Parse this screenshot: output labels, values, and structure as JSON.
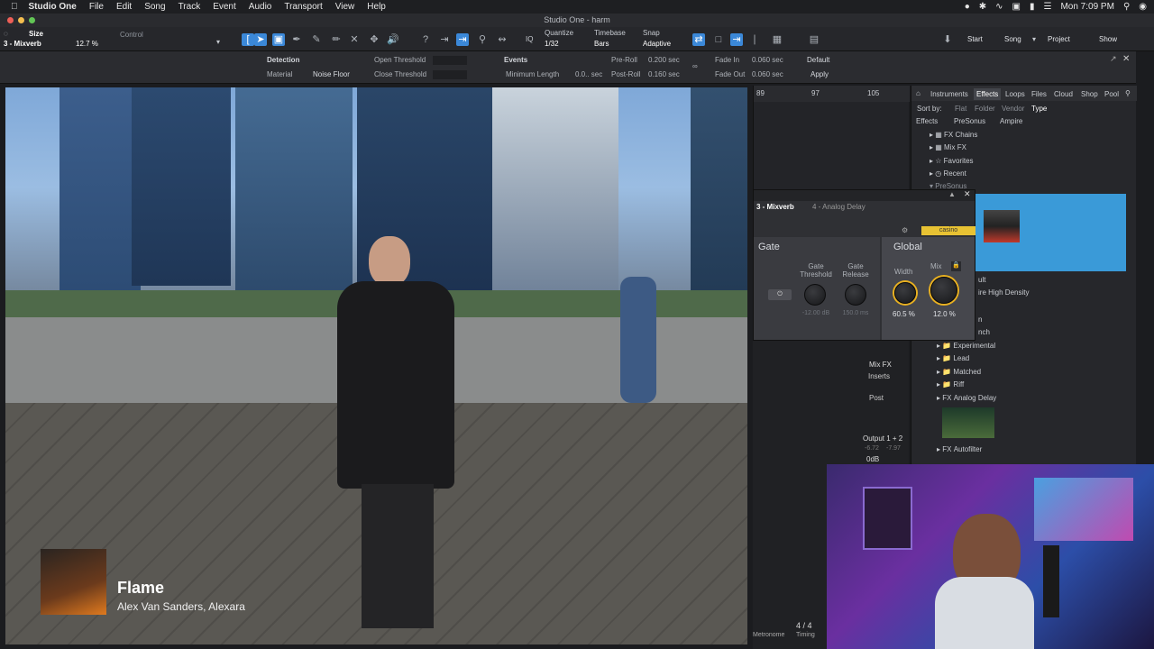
{
  "menubar": {
    "app": "Studio One",
    "items": [
      "File",
      "Edit",
      "Song",
      "Track",
      "Event",
      "Audio",
      "Transport",
      "View",
      "Help"
    ],
    "clock": "Mon 7:09 PM"
  },
  "window": {
    "title": "Studio One - harm"
  },
  "toolbar": {
    "track_name": "3 - Mixverb",
    "size_label": "Size",
    "size_value": "12.7 %",
    "control_label": "Control",
    "quantize_label": "Quantize",
    "quantize_value": "1/32",
    "timebase_label": "Timebase",
    "timebase_value": "Bars",
    "snap_label": "Snap",
    "snap_value": "Adaptive",
    "nav": [
      "Start",
      "Song",
      "Project",
      "Show"
    ]
  },
  "inspector": {
    "detection": "Detection",
    "material_label": "Material",
    "material_value": "Noise Floor",
    "open_threshold": "Open Threshold",
    "close_threshold": "Close Threshold",
    "events": "Events",
    "minimum_length": "Minimum Length",
    "minimum_length_value": "0.0.. sec",
    "pre_roll": "Pre-Roll",
    "pre_roll_value": "0.200 sec",
    "post_roll": "Post-Roll",
    "post_roll_value": "0.160 sec",
    "fade_in": "Fade In",
    "fade_in_value": "0.060 sec",
    "fade_out": "Fade Out",
    "fade_out_value": "0.060 sec",
    "default_btn": "Default",
    "apply_btn": "Apply"
  },
  "arrange": {
    "ruler": [
      "89",
      "97",
      "105"
    ]
  },
  "browser": {
    "tabs": [
      "Instruments",
      "Effects",
      "Loops",
      "Files",
      "Cloud",
      "Shop",
      "Pool"
    ],
    "sort_by": "Sort by:",
    "sort_options": [
      "Flat",
      "Folder",
      "Vendor",
      "Type"
    ],
    "breadcrumb": [
      "Effects",
      "PreSonus",
      "Ampire"
    ],
    "items": [
      "FX Chains",
      "Mix FX",
      "Favorites",
      "Recent",
      "PreSonus"
    ],
    "sub_items": [
      "ire High Density",
      "Experimental",
      "Lead",
      "Matched",
      "Riff",
      "Analog Delay",
      "Autofilter"
    ],
    "partial": [
      "ult",
      "n",
      "nch"
    ]
  },
  "plugin": {
    "track": "3 - Mixverb",
    "insert": "4 - Analog Delay",
    "preset": "casino",
    "gate_title": "Gate",
    "global_title": "Global",
    "gate_threshold_label": "Gate Threshold",
    "gate_threshold_value": "-12.00 dB",
    "gate_release_label": "Gate Release",
    "gate_release_value": "150.0 ms",
    "width_label": "Width",
    "width_value": "60.5 %",
    "mix_label": "Mix",
    "mix_value": "12.0 %"
  },
  "mixer": {
    "mixfx": "Mix FX",
    "inserts": "Inserts",
    "post": "Post",
    "output": "Output 1 + 2",
    "levels": [
      "-6.72",
      "-7.97"
    ],
    "db": "0dB",
    "counter": "4 / 4",
    "metronome": "Metronome",
    "timing": "Timing"
  },
  "song": {
    "title": "Flame",
    "artist": "Alex Van Sanders, Alexara"
  },
  "colors": {
    "accent": "#3b88d8",
    "preset_bg": "#e8c233",
    "knob_ring": "#e8b020"
  }
}
